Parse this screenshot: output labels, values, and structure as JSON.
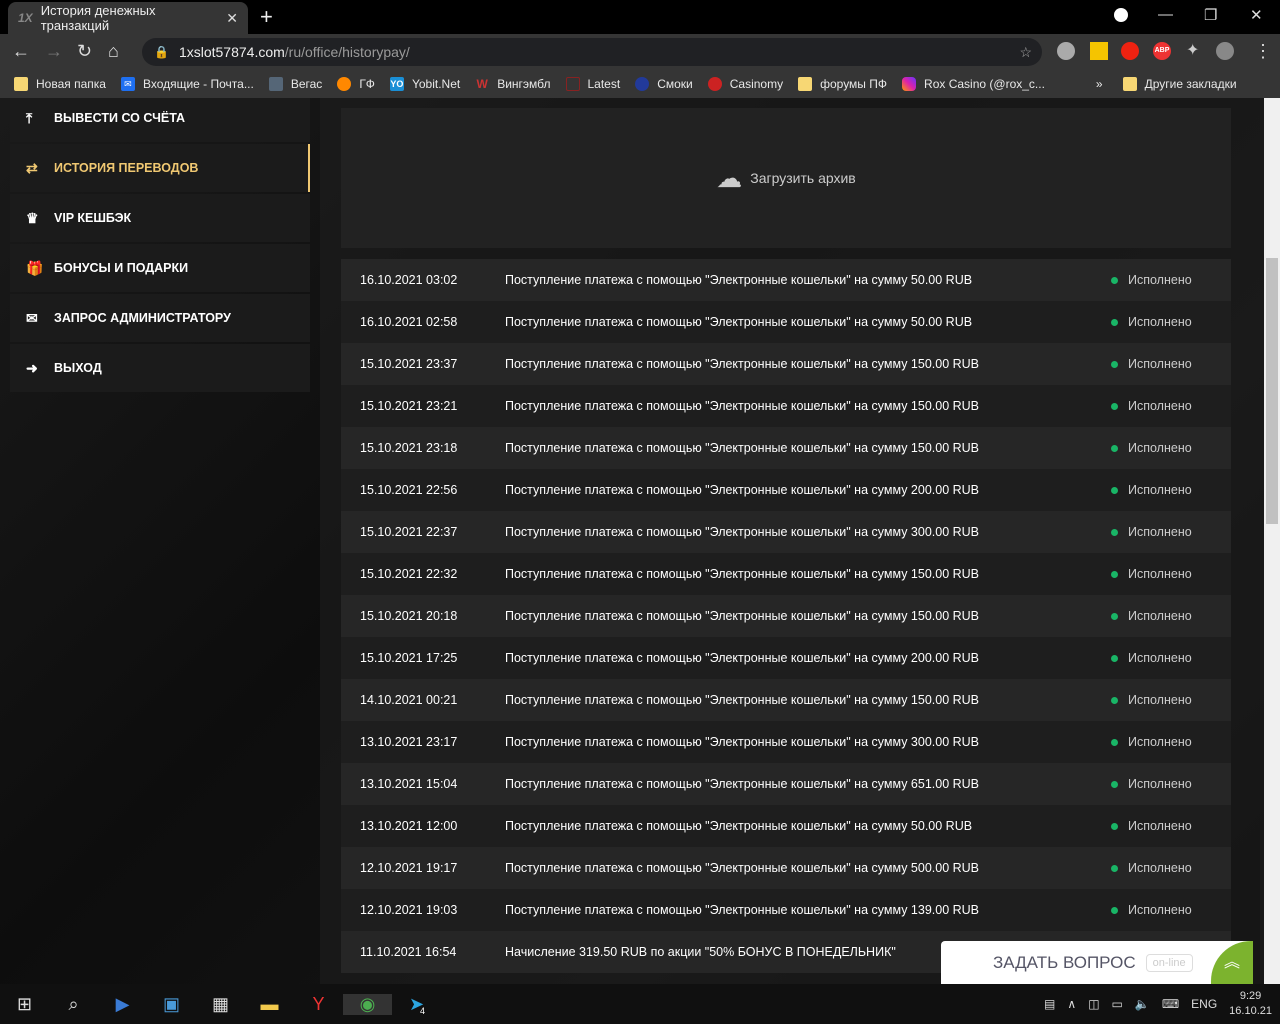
{
  "browser": {
    "tab_title": "История денежных транзакций",
    "tab_favicon": "1X",
    "url_host": "1xslot57874.com",
    "url_path": "/ru/office/historypay/",
    "bookmarks": [
      "Новая папка",
      "Входящие - Почта...",
      "Вегас",
      "ГФ",
      "Yobit.Net",
      "Вингэмбл",
      "Latest",
      "Смоки",
      "Casinomy",
      "форумы ПФ",
      "Rox Casino (@rox_c..."
    ],
    "more": "»",
    "other_bookmarks": "Другие закладки",
    "ext_abp": "ABP"
  },
  "sidebar": {
    "items": [
      {
        "label": "ВЫВЕСТИ СО СЧЁТА",
        "icon": "upload-icon"
      },
      {
        "label": "ИСТОРИЯ ПЕРЕВОДОВ",
        "icon": "transfer-icon",
        "active": true
      },
      {
        "label": "VIP КЕШБЭК",
        "icon": "crown-icon"
      },
      {
        "label": "БОНУСЫ И ПОДАРКИ",
        "icon": "gift-icon"
      },
      {
        "label": "ЗАПРОС АДМИНИСТРАТОРУ",
        "icon": "envelope-icon"
      },
      {
        "label": "ВЫХОД",
        "icon": "logout-icon"
      }
    ]
  },
  "main": {
    "upload_label": "Загрузить архив",
    "rows": [
      {
        "date": "16.10.2021 03:02",
        "desc": "Поступление платежа с помощью \"Электронные кошельки\" на сумму 50.00 RUB",
        "status": "Исполнено"
      },
      {
        "date": "16.10.2021 02:58",
        "desc": "Поступление платежа с помощью \"Электронные кошельки\" на сумму 50.00 RUB",
        "status": "Исполнено"
      },
      {
        "date": "15.10.2021 23:37",
        "desc": "Поступление платежа с помощью \"Электронные кошельки\" на сумму 150.00 RUB",
        "status": "Исполнено"
      },
      {
        "date": "15.10.2021 23:21",
        "desc": "Поступление платежа с помощью \"Электронные кошельки\" на сумму 150.00 RUB",
        "status": "Исполнено"
      },
      {
        "date": "15.10.2021 23:18",
        "desc": "Поступление платежа с помощью \"Электронные кошельки\" на сумму 150.00 RUB",
        "status": "Исполнено"
      },
      {
        "date": "15.10.2021 22:56",
        "desc": "Поступление платежа с помощью \"Электронные кошельки\" на сумму 200.00 RUB",
        "status": "Исполнено"
      },
      {
        "date": "15.10.2021 22:37",
        "desc": "Поступление платежа с помощью \"Электронные кошельки\" на сумму 300.00 RUB",
        "status": "Исполнено"
      },
      {
        "date": "15.10.2021 22:32",
        "desc": "Поступление платежа с помощью \"Электронные кошельки\" на сумму 150.00 RUB",
        "status": "Исполнено"
      },
      {
        "date": "15.10.2021 20:18",
        "desc": "Поступление платежа с помощью \"Электронные кошельки\" на сумму 150.00 RUB",
        "status": "Исполнено"
      },
      {
        "date": "15.10.2021 17:25",
        "desc": "Поступление платежа с помощью \"Электронные кошельки\" на сумму 200.00 RUB",
        "status": "Исполнено"
      },
      {
        "date": "14.10.2021 00:21",
        "desc": "Поступление платежа с помощью \"Электронные кошельки\" на сумму 150.00 RUB",
        "status": "Исполнено"
      },
      {
        "date": "13.10.2021 23:17",
        "desc": "Поступление платежа с помощью \"Электронные кошельки\" на сумму 300.00 RUB",
        "status": "Исполнено"
      },
      {
        "date": "13.10.2021 15:04",
        "desc": "Поступление платежа с помощью \"Электронные кошельки\" на сумму 651.00 RUB",
        "status": "Исполнено"
      },
      {
        "date": "13.10.2021 12:00",
        "desc": "Поступление платежа с помощью \"Электронные кошельки\" на сумму 50.00 RUB",
        "status": "Исполнено"
      },
      {
        "date": "12.10.2021 19:17",
        "desc": "Поступление платежа с помощью \"Электронные кошельки\" на сумму 500.00 RUB",
        "status": "Исполнено"
      },
      {
        "date": "12.10.2021 19:03",
        "desc": "Поступление платежа с помощью \"Электронные кошельки\" на сумму 139.00 RUB",
        "status": "Исполнено"
      },
      {
        "date": "11.10.2021 16:54",
        "desc": "Начисление 319.50 RUB по акции \"50% БОНУС В ПОНЕДЕЛЬНИК\"",
        "status": ""
      }
    ]
  },
  "chat": {
    "label": "ЗАДАТЬ ВОПРОС",
    "status": "on-line"
  },
  "taskbar": {
    "lang": "ENG",
    "time": "9:29",
    "date": "16.10.21",
    "telegram_badge": "4"
  }
}
